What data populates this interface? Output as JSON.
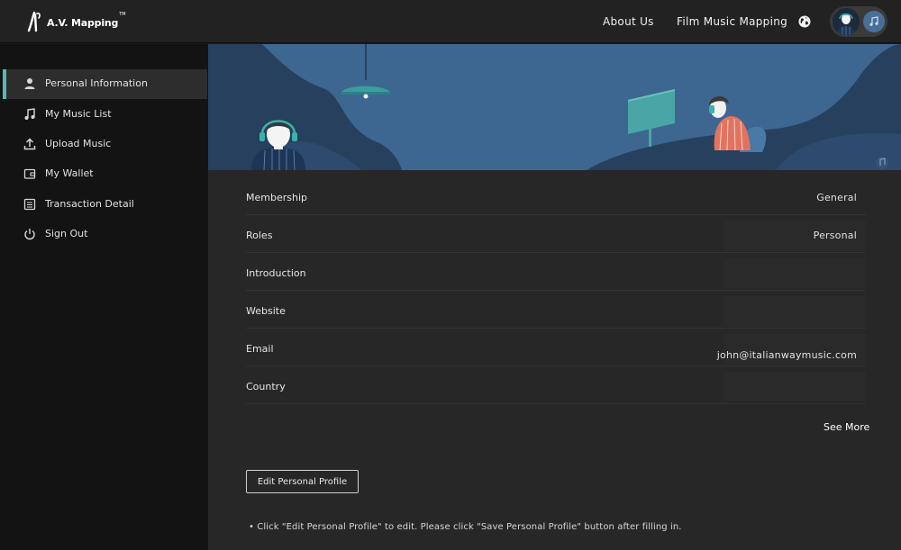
{
  "header": {
    "logo_text": "A.V. Mapping",
    "logo_tm": "TM",
    "nav": [
      {
        "label": "About Us"
      },
      {
        "label": "Film Music Mapping"
      }
    ],
    "globe_icon": "globe-icon",
    "music_icon": "music-note-icon"
  },
  "sidebar": {
    "items": [
      {
        "label": "Personal Information",
        "icon": "user-icon",
        "active": true
      },
      {
        "label": "My Music List",
        "icon": "music-note-icon",
        "active": false
      },
      {
        "label": "Upload Music",
        "icon": "upload-icon",
        "active": false
      },
      {
        "label": "My Wallet",
        "icon": "wallet-icon",
        "active": false
      },
      {
        "label": "Transaction Detail",
        "icon": "list-document-icon",
        "active": false
      },
      {
        "label": "Sign Out",
        "icon": "power-icon",
        "active": false
      }
    ]
  },
  "profile": {
    "fields": [
      {
        "label": "Membership",
        "value": "General"
      },
      {
        "label": "Roles",
        "value": "Personal"
      },
      {
        "label": "Introduction",
        "value": ""
      },
      {
        "label": "Website",
        "value": ""
      },
      {
        "label": "Email",
        "value": "john@italianwaymusic.com"
      },
      {
        "label": "Country",
        "value": ""
      }
    ],
    "see_more": "See More",
    "edit_button": "Edit Personal Profile",
    "note": "• Click \"Edit Personal Profile\" to edit. Please click \"Save Personal Profile\" button after filling in."
  },
  "colors": {
    "accent": "#58b9b0",
    "banner_blue": "#3d6690",
    "banner_dark": "#26405e",
    "background": "#272727",
    "sidebar": "#131313"
  }
}
